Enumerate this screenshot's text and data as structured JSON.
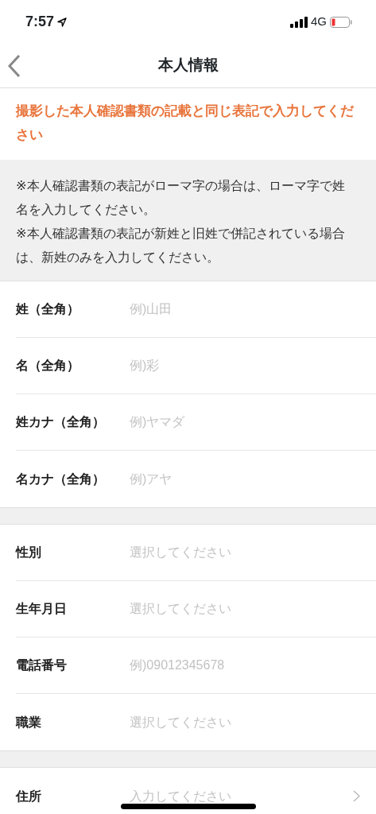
{
  "status_bar": {
    "time": "7:57",
    "network": "4G"
  },
  "nav": {
    "title": "本人情報"
  },
  "notice": "撮影した本人確認書類の記載と同じ表記で入力してください",
  "notes": [
    "※本人確認書類の表記がローマ字の場合は、ローマ字で姓名を入力してください。",
    "※本人確認書類の表記が新姓と旧姓で併記されている場合は、新姓のみを入力してください。"
  ],
  "groups": [
    {
      "rows": [
        {
          "label": "姓（全角）",
          "kind": "input",
          "placeholder": "例)山田"
        },
        {
          "label": "名（全角）",
          "kind": "input",
          "placeholder": "例)彩"
        },
        {
          "label": "姓カナ（全角）",
          "kind": "input",
          "placeholder": "例)ヤマダ"
        },
        {
          "label": "名カナ（全角）",
          "kind": "input",
          "placeholder": "例)アヤ"
        }
      ]
    },
    {
      "rows": [
        {
          "label": "性別",
          "kind": "select",
          "placeholder": "選択してください"
        },
        {
          "label": "生年月日",
          "kind": "select",
          "placeholder": "選択してください"
        },
        {
          "label": "電話番号",
          "kind": "input",
          "placeholder": "例)09012345678"
        },
        {
          "label": "職業",
          "kind": "select",
          "placeholder": "選択してください"
        }
      ]
    },
    {
      "rows": [
        {
          "label": "住所",
          "kind": "link",
          "placeholder": "入力してください"
        }
      ]
    }
  ]
}
